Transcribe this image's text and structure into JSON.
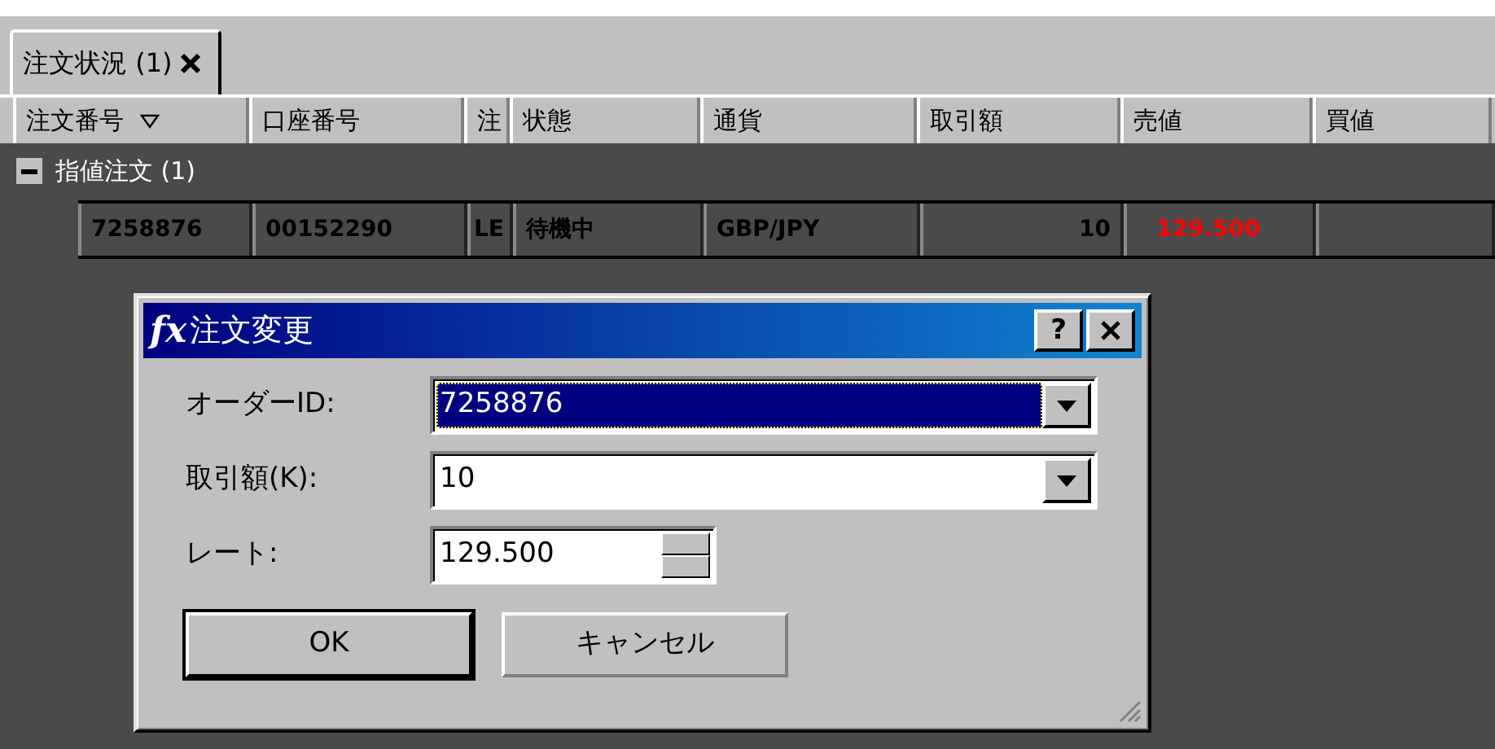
{
  "tab": {
    "label": "注文状況 (1)",
    "selected": true
  },
  "columns": [
    {
      "label": "注文番号",
      "sorted": true,
      "kind": "text"
    },
    {
      "label": "口座番号",
      "sorted": false,
      "kind": "text"
    },
    {
      "label": "注",
      "sorted": false,
      "kind": "text"
    },
    {
      "label": "状態",
      "sorted": false,
      "kind": "text"
    },
    {
      "label": "通貨",
      "sorted": false,
      "kind": "text"
    },
    {
      "label": "取引額",
      "sorted": false,
      "kind": "amount"
    },
    {
      "label": "売値",
      "sorted": false,
      "kind": "price"
    },
    {
      "label": "買値",
      "sorted": false,
      "kind": "text"
    }
  ],
  "groups": [
    {
      "label": "指値注文 (1)",
      "expanded": true,
      "rows": [
        {
          "cells": [
            "7258876",
            "00152290",
            "LE",
            "待機中",
            "GBP/JPY",
            "10",
            "129.500",
            ""
          ]
        }
      ]
    }
  ],
  "dialog": {
    "icon_text": "fx",
    "title": "注文変更",
    "help_button": "?",
    "fields": [
      {
        "kind": "combo",
        "label": "オーダーID:",
        "value": "7258876",
        "focused": true
      },
      {
        "kind": "combo",
        "label": "取引額(K):",
        "value": "10",
        "focused": false
      },
      {
        "kind": "spin",
        "label": "レート:",
        "value": "129.500",
        "focused": false
      }
    ],
    "buttons": [
      {
        "label": "OK",
        "default": true
      },
      {
        "label": "キャンセル",
        "default": false
      }
    ]
  }
}
